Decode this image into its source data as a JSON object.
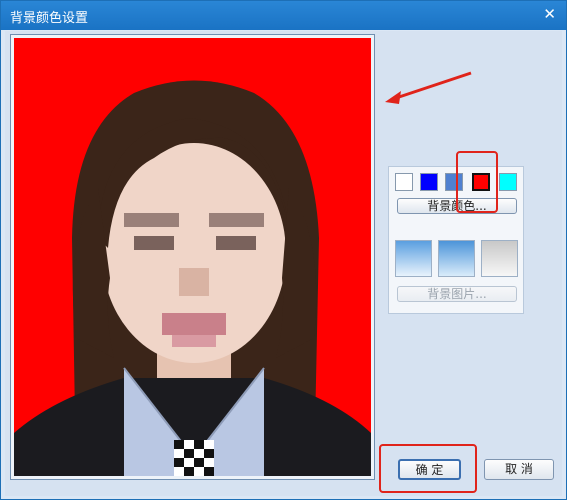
{
  "window": {
    "title": "背景颜色设置",
    "close_glyph": "✕"
  },
  "colors": {
    "accent": "#1a73c4",
    "photo_background": "#ff0000",
    "highlight": "#e0241b"
  },
  "background_panel": {
    "swatches": [
      {
        "name": "white",
        "color": "#ffffff"
      },
      {
        "name": "blue",
        "color": "#0000ff"
      },
      {
        "name": "steel-blue",
        "color": "#4f80d0"
      },
      {
        "name": "red",
        "color": "#ff0000",
        "selected": true
      },
      {
        "name": "cyan",
        "color": "#00ffff"
      }
    ],
    "color_button_label": "背景颜色...",
    "image_button_label": "背景图片...",
    "background_images": [
      "sky-blue-gradient",
      "light-blue-gradient",
      "gray-gradient"
    ]
  },
  "footer": {
    "ok_label": "确 定",
    "cancel_label": "取 消"
  }
}
